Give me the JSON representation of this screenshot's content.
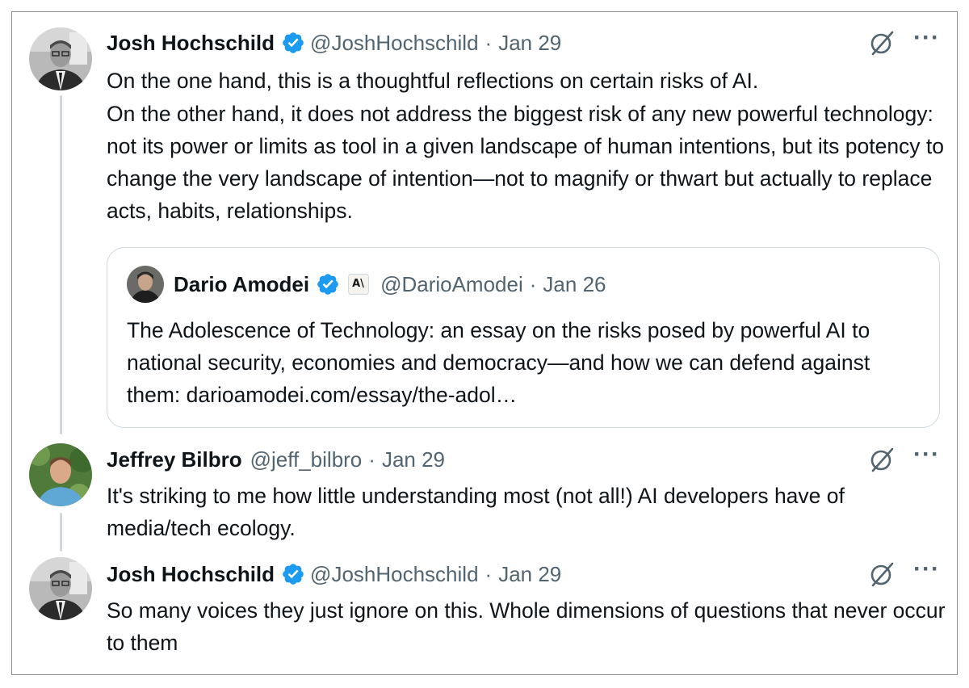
{
  "tweets": [
    {
      "name": "Josh Hochschild",
      "handle": "@JoshHochschild",
      "separator": "·",
      "date": "Jan 29",
      "verified": true,
      "paragraphs": [
        "On the one hand, this is a thoughtful reflections on certain risks of AI.",
        "On the other hand, it does not address the biggest risk of any new powerful technology: not its power or limits as tool in a given landscape of human intentions, but its potency to change the  very landscape of intention—not to magnify or thwart but actually to replace acts, habits, relationships."
      ],
      "quoted": {
        "name": "Dario Amodei",
        "handle": "@DarioAmodei",
        "separator": "·",
        "date": "Jan 26",
        "verified": true,
        "affiliate_badge": "A\\",
        "text": "The Adolescence of Technology: an essay on the risks posed by powerful AI to national security, economies and democracy—and how we can defend against them: darioamodei.com/essay/the-adol…"
      }
    },
    {
      "name": "Jeffrey Bilbro",
      "handle": "@jeff_bilbro",
      "separator": "·",
      "date": "Jan 29",
      "verified": false,
      "paragraphs": [
        "It's striking to me how little understanding most (not all!) AI developers have of media/tech ecology."
      ]
    },
    {
      "name": "Josh Hochschild",
      "handle": "@JoshHochschild",
      "separator": "·",
      "date": "Jan 29",
      "verified": true,
      "paragraphs": [
        "So many voices they just ignore on this. Whole dimensions of questions that never occur to them"
      ]
    }
  ],
  "icons": {
    "verified": "verified-badge-icon",
    "grok": "grok-icon",
    "more": "more-options-icon",
    "more_glyph": "···"
  },
  "colors": {
    "verified_blue": "#1d9bf0",
    "secondary_text": "#536471",
    "primary_text": "#0f1419",
    "thread_line": "#cfd9de"
  }
}
